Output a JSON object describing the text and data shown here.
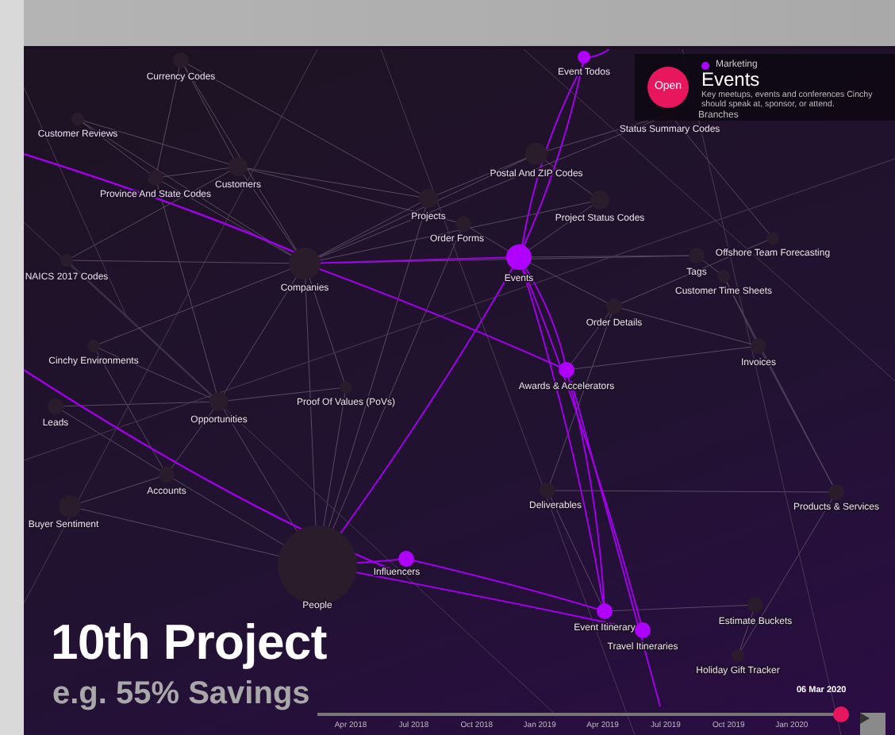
{
  "graph": {
    "nodes": [
      {
        "label": "Currency Codes",
        "color": "#2b1c2c"
      },
      {
        "label": "Customer Reviews",
        "color": "#2b1c2c"
      },
      {
        "label": "Province And State Codes",
        "color": "#2b1c2c"
      },
      {
        "label": "Customers",
        "color": "#2b1c2c"
      },
      {
        "label": "Projects",
        "color": "#2b1c2c"
      },
      {
        "label": "Event Todos",
        "color": "#b000ff"
      },
      {
        "label": "Status Summary Codes",
        "color": "#2b1c2c"
      },
      {
        "label": "Postal And ZIP Codes",
        "color": "#2b1c2c"
      },
      {
        "label": "Project Status Codes",
        "color": "#2b1c2c"
      },
      {
        "label": "Order Forms",
        "color": "#2b1c2c"
      },
      {
        "label": "Events",
        "color": "#b000ff"
      },
      {
        "label": "Offshore Team Forecasting",
        "color": "#2b1c2c"
      },
      {
        "label": "Tags",
        "color": "#2b1c2c"
      },
      {
        "label": "Customer Time Sheets",
        "color": "#2b1c2c"
      },
      {
        "label": "Order Details",
        "color": "#2b1c2c"
      },
      {
        "label": "NAICS 2017 Codes",
        "color": "#2b1c2c"
      },
      {
        "label": "Companies",
        "color": "#2b1c2c"
      },
      {
        "label": "Invoices",
        "color": "#2b1c2c"
      },
      {
        "label": "Awards & Accelerators",
        "color": "#b000ff"
      },
      {
        "label": "Cinchy Environments",
        "color": "#2b1c2c"
      },
      {
        "label": "Leads",
        "color": "#2b1c2c"
      },
      {
        "label": "Opportunities",
        "color": "#2b1c2c"
      },
      {
        "label": "Proof Of Values (PoVs)",
        "color": "#2b1c2c"
      },
      {
        "label": "Accounts",
        "color": "#2b1c2c"
      },
      {
        "label": "Buyer Sentiment",
        "color": "#2b1c2c"
      },
      {
        "label": "Deliverables",
        "color": "#2b1c2c"
      },
      {
        "label": "Products & Services",
        "color": "#2b1c2c"
      },
      {
        "label": "People",
        "color": "#2b1c2c"
      },
      {
        "label": "Influencers",
        "color": "#b000ff"
      },
      {
        "label": "Event Itinerary",
        "color": "#b000ff"
      },
      {
        "label": "Estimate Buckets",
        "color": "#2b1c2c"
      },
      {
        "label": "Travel Itineraries",
        "color": "#b000ff"
      },
      {
        "label": "Holiday Gift Tracker",
        "color": "#2b1c2c"
      }
    ]
  },
  "popup": {
    "button": "Open",
    "category": "Marketing",
    "title": "Events",
    "description": "Key meetups, events and conferences Cinchy should speak at, sponsor, or attend.",
    "link": "Branches"
  },
  "overlay": {
    "headline": "10th Project",
    "subline": "e.g. 55% Savings"
  },
  "timeline": {
    "current_date": "06 Mar 2020",
    "level": 1,
    "ticks": [
      "Apr 2018",
      "Jul 2018",
      "Oct 2018",
      "Jan 2019",
      "Apr 2019",
      "Jul 2019",
      "Oct 2019",
      "Jan 2020"
    ]
  }
}
